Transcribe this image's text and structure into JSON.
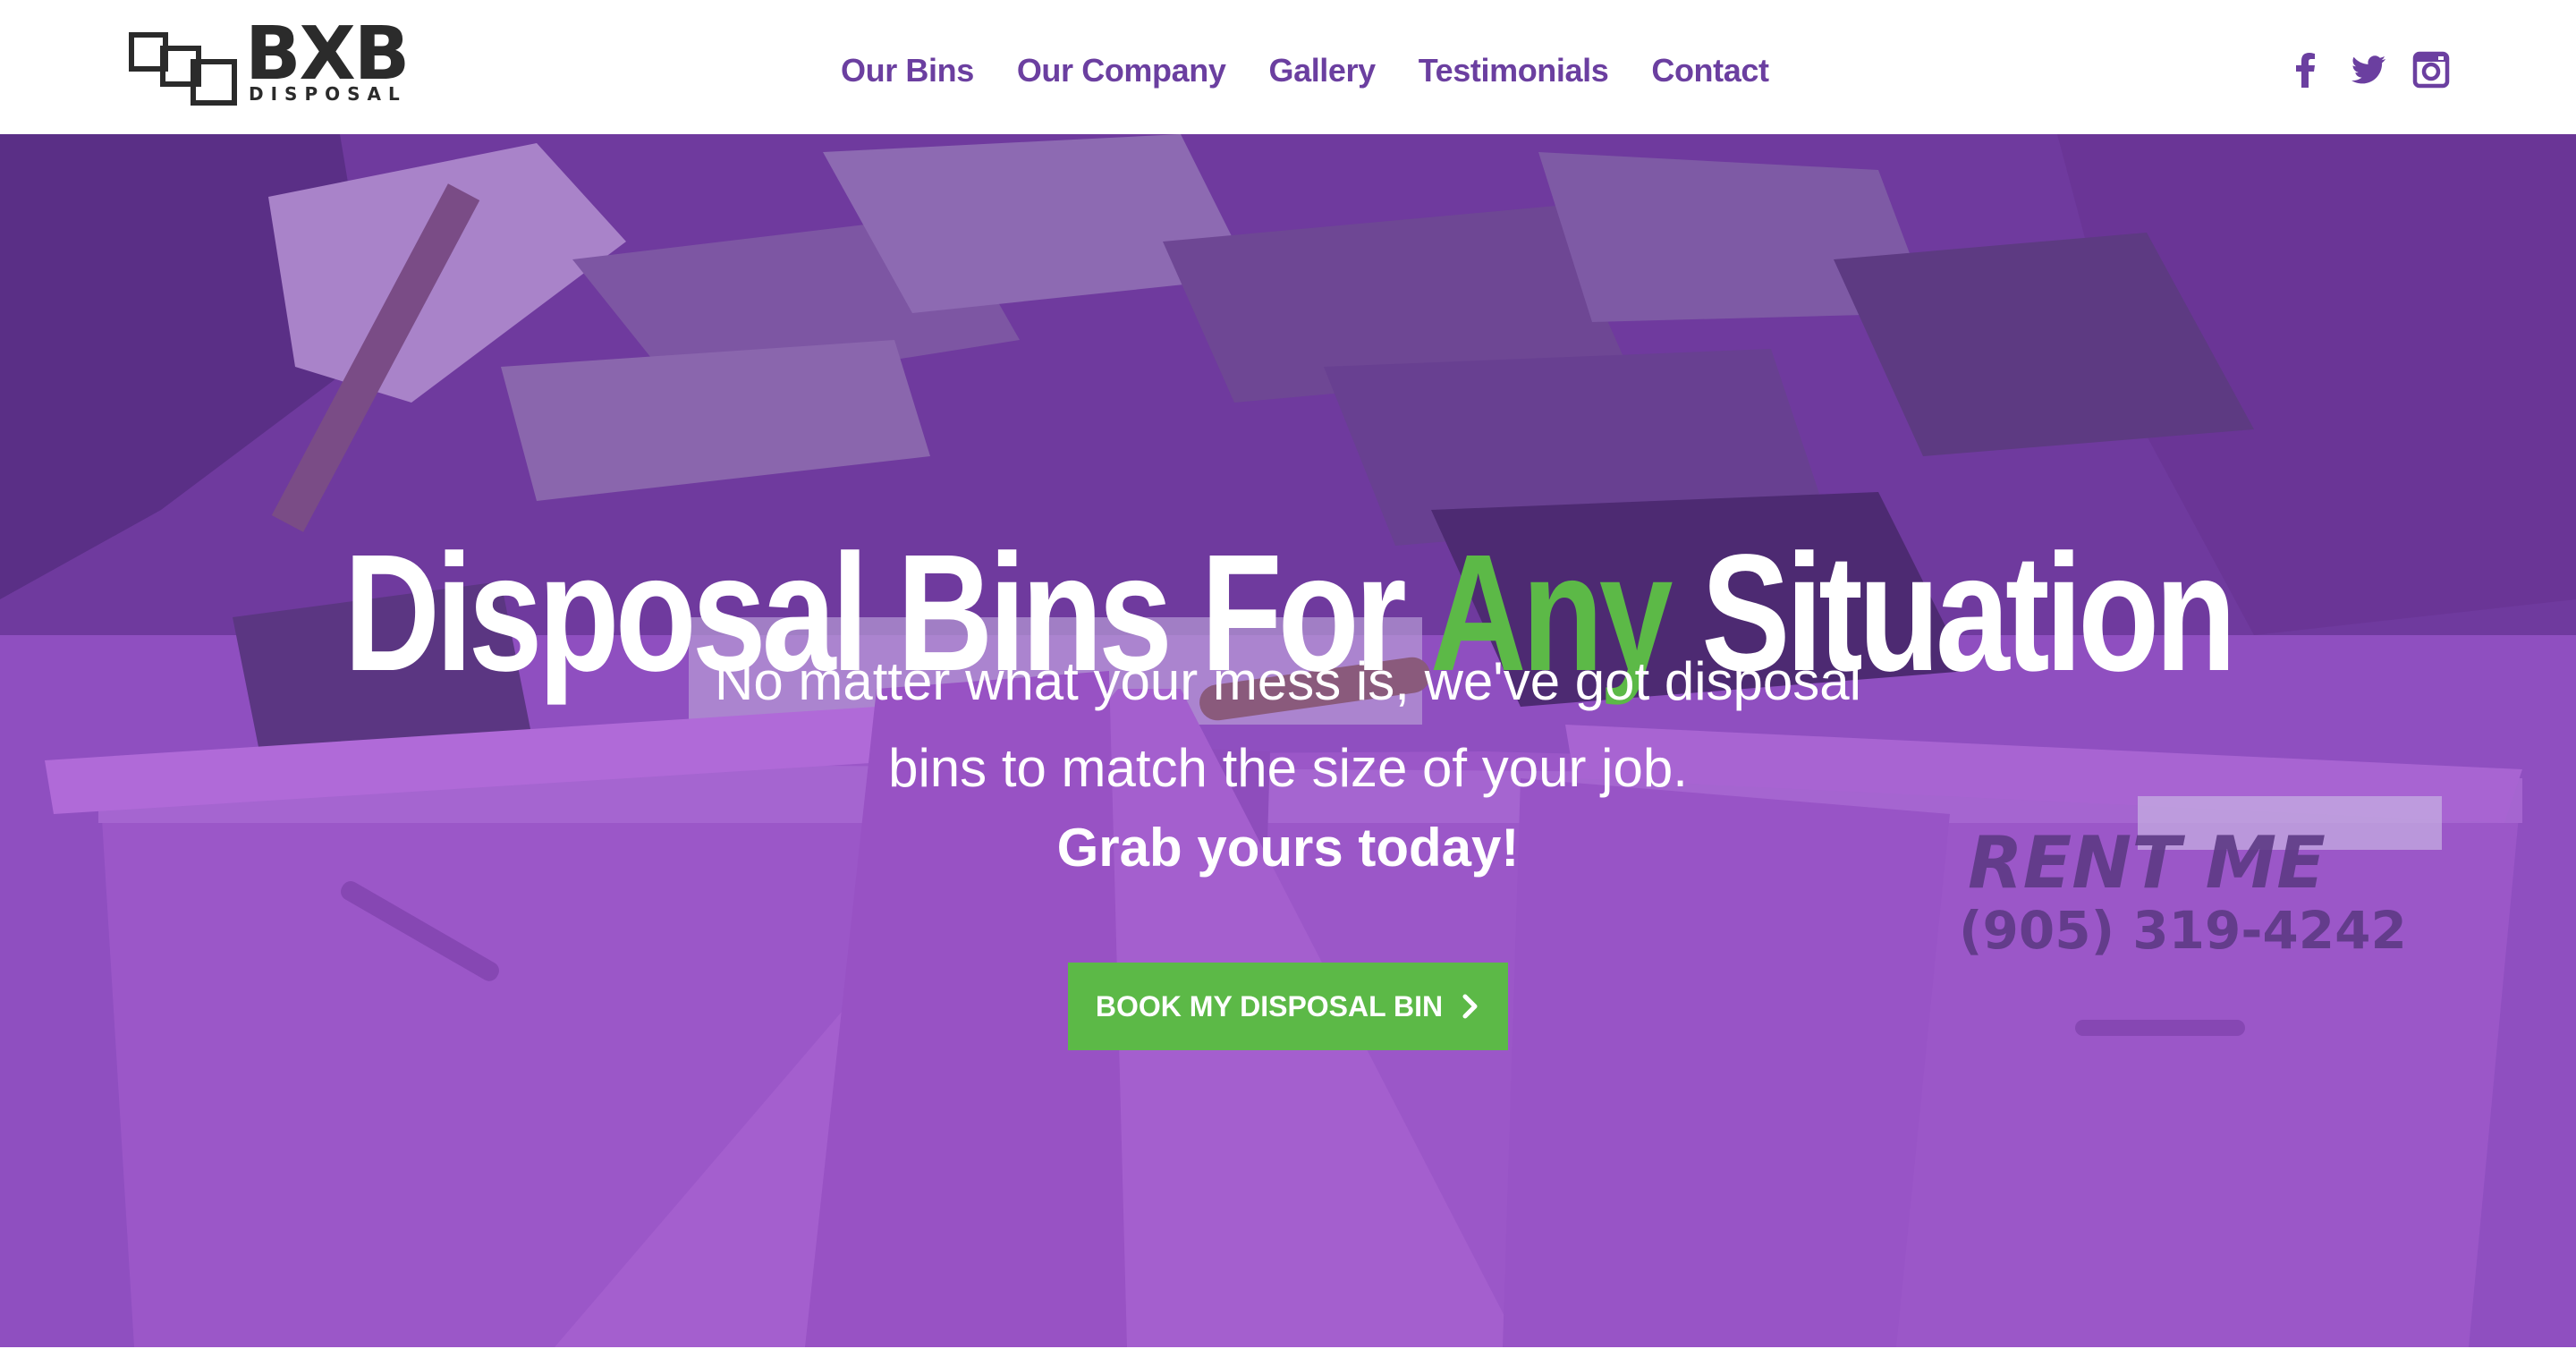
{
  "header": {
    "logo": {
      "wordmark": "BXB",
      "subtitle": "DISPOSAL"
    },
    "nav": [
      {
        "label": "Our Bins"
      },
      {
        "label": "Our Company"
      },
      {
        "label": "Gallery"
      },
      {
        "label": "Testimonials"
      },
      {
        "label": "Contact"
      }
    ],
    "social": [
      {
        "icon": "facebook-icon"
      },
      {
        "icon": "twitter-icon"
      },
      {
        "icon": "instagram-icon"
      }
    ]
  },
  "hero": {
    "title_before": "Disposal Bins For ",
    "title_accent": "Any",
    "title_after": " Situation",
    "subtitle_line1": "No matter what your mess is, we've got disposal",
    "subtitle_line2": "bins to match the size of your job.",
    "cta_text": "Grab yours today!",
    "button_label": "BOOK MY DISPOSAL BIN",
    "bin_print": {
      "line1": "RENT ME",
      "line2": "(905) 319-4242"
    }
  },
  "colors": {
    "brand_purple": "#6b3fa0",
    "accent_green": "#5cb947",
    "overlay_purple": "#9a5ac8",
    "dark_text": "#2b2b2b"
  }
}
